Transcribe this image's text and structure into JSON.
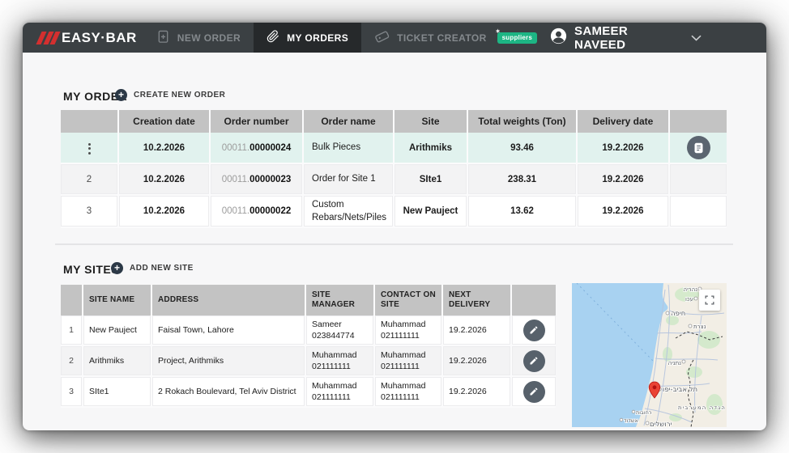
{
  "colors": {
    "brand_red": "#d32f2f",
    "nav_bg": "#3b4043",
    "active_tab_bg": "#26292b",
    "badge_green": "#1db584",
    "row_highlight": "#e1f2ee",
    "table_header_gray": "#c3c3c3"
  },
  "icons": {
    "plus": "+",
    "badge_star": "✶"
  },
  "nav": {
    "logo_text": "EASY·BAR",
    "tabs": [
      {
        "label": "NEW ORDER",
        "icon": "file-plus-icon",
        "active": false
      },
      {
        "label": "MY ORDERS",
        "icon": "paperclip-icon",
        "active": true
      },
      {
        "label": "TICKET CREATOR",
        "icon": "ticket-icon",
        "badge": "suppliers",
        "active": false
      }
    ],
    "user": {
      "name": "SAMEER NAVEED"
    }
  },
  "orders": {
    "title": "MY ORDER",
    "create_button": "CREATE NEW ORDER",
    "columns": [
      "",
      "Creation date",
      "Order number",
      "Order name",
      "Site",
      "Total weights (Ton)",
      "Delivery date",
      ""
    ],
    "rows": [
      {
        "index": "",
        "creation_date": "10.2.2026",
        "order_prefix": "00011.",
        "order_number": "00000024",
        "order_name": "Bulk Pieces",
        "site": "Arithmiks",
        "total_weight": "93.46",
        "delivery_date": "19.2.2026"
      },
      {
        "index": "2",
        "creation_date": "10.2.2026",
        "order_prefix": "00011.",
        "order_number": "00000023",
        "order_name": "Order for Site 1",
        "site": "SIte1",
        "total_weight": "238.31",
        "delivery_date": "19.2.2026"
      },
      {
        "index": "3",
        "creation_date": "10.2.2026",
        "order_prefix": "00011.",
        "order_number": "00000022",
        "order_name": "Custom Rebars/Nets/Piles",
        "site": "New Pauject",
        "total_weight": "13.62",
        "delivery_date": "19.2.2026"
      }
    ]
  },
  "sites": {
    "title": "MY SITES",
    "add_button": "ADD NEW SITE",
    "columns": [
      "",
      "SITE NAME",
      "ADDRESS",
      "SITE MANAGER",
      "CONTACT ON SITE",
      "NEXT DELIVERY",
      ""
    ],
    "rows": [
      {
        "index": "1",
        "name": "New Pauject",
        "address": "Faisal Town, Lahore",
        "manager_name": "Sameer",
        "manager_phone": "023844774",
        "contact_name": "Muhammad",
        "contact_phone": "021111111",
        "next_delivery": "19.2.2026"
      },
      {
        "index": "2",
        "name": "Arithmiks",
        "address": "Project, Arithmiks",
        "manager_name": "Muhammad",
        "manager_phone": "021111111",
        "contact_name": "Muhammad",
        "contact_phone": "021111111",
        "next_delivery": "19.2.2026"
      },
      {
        "index": "3",
        "name": "SIte1",
        "address": "2 Rokach Boulevard, Tel Aviv District",
        "manager_name": "Muhammad",
        "manager_phone": "021111111",
        "contact_name": "Muhammad",
        "contact_phone": "021111111",
        "next_delivery": "19.2.2026"
      }
    ]
  },
  "map": {
    "labels": [
      "נהריה",
      "עכו",
      "חיפה",
      "נצרת",
      "נתניה",
      "תל אביב-יפו",
      "הגדה המערבית",
      "רחובות",
      "אשדוד",
      "ירושלים"
    ]
  }
}
